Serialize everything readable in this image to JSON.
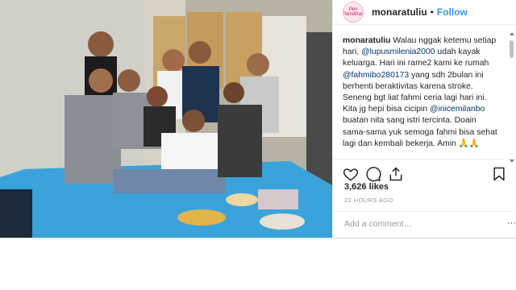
{
  "post": {
    "username": "monaratuliu",
    "follow_label": "Follow",
    "separator": "•",
    "avatar_text": "Peri Pemilihan",
    "caption": {
      "username": "monaratuliu",
      "part1": " Walau nggak ketemu setiap hari, ",
      "mention1": "@lupusmilenia2000",
      "part2": " udah kayak keluarga. Hari ini rame2 kami ke rumah ",
      "mention2": "@fahmibo280173",
      "part3": " yang sdh 2bulan ini berhenti beraktivitas karena stroke. Seneng bgt liat fahmi ceria lagi hari ini. Kita jg hepi bisa cicipin ",
      "mention3": "@inicemilanbo",
      "part4": " buatan nita sang istri tercinta. Doain sama-sama yuk semoga fahmi bisa sehat lagi dan kembali bekerja. Amin 🙏🙏"
    },
    "likes": "3,626 likes",
    "timestamp": "22 HOURS AGO",
    "comment_placeholder": "Add a comment…",
    "more_label": "···"
  },
  "icons": [
    "heart-icon",
    "comment-icon",
    "share-icon",
    "bookmark-icon"
  ]
}
